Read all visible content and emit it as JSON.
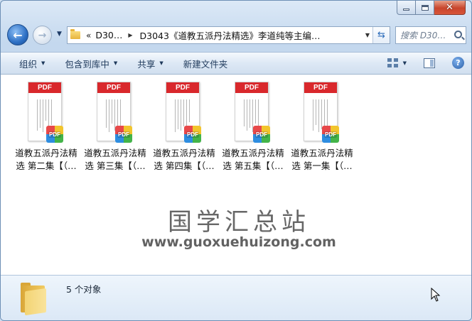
{
  "navigation": {
    "address_chevron": "«",
    "breadcrumb": [
      "D30…",
      "D3043《道教五派丹法精选》李道纯等主编…"
    ],
    "search_placeholder": "搜索 D30…"
  },
  "toolbar": {
    "organize": "组织",
    "include_in_library": "包含到库中",
    "share": "共享",
    "new_folder": "新建文件夹"
  },
  "files": [
    {
      "line1": "道教五派丹法精",
      "line2": "选 第二集【（…",
      "icon": "pdf-file-icon",
      "badge": "PDF"
    },
    {
      "line1": "道教五派丹法精",
      "line2": "选 第三集【（…",
      "icon": "pdf-file-icon",
      "badge": "PDF"
    },
    {
      "line1": "道教五派丹法精",
      "line2": "选 第四集【（…",
      "icon": "pdf-file-icon",
      "badge": "PDF"
    },
    {
      "line1": "道教五派丹法精",
      "line2": "选 第五集【（…",
      "icon": "pdf-file-icon",
      "badge": "PDF"
    },
    {
      "line1": "道教五派丹法精",
      "line2": "选 第一集【（…",
      "icon": "pdf-file-icon",
      "badge": "PDF"
    }
  ],
  "pdf_band_label": "PDF",
  "watermark": {
    "title": "国学汇总站",
    "url": "www.guoxuehuizong.com"
  },
  "details": {
    "object_count": "5 个对象"
  },
  "colors": {
    "pdf_red": "#d9282c",
    "window_chrome": "#c4d8ee",
    "close_button": "#c8452c"
  }
}
